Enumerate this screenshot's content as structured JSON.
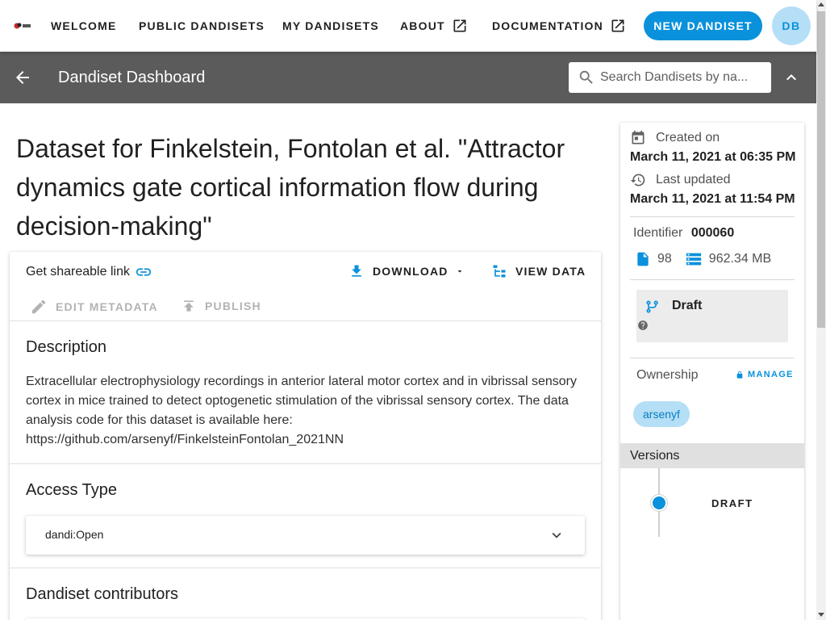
{
  "nav": {
    "welcome": "WELCOME",
    "public_dandisets": "PUBLIC DANDISETS",
    "my_dandisets": "MY DANDISETS",
    "about": "ABOUT",
    "documentation": "DOCUMENTATION",
    "new_dandiset": "NEW DANDISET",
    "user_initials": "DB"
  },
  "toolbar": {
    "title": "Dandiset Dashboard",
    "search_placeholder": "Search Dandisets by na..."
  },
  "dandiset": {
    "title": "Dataset for Finkelstein, Fontolan et al. \"Attractor dynamics gate cortical information flow during decision-making\"",
    "share_link_label": "Get shareable link",
    "download_label": "DOWNLOAD",
    "view_data_label": "VIEW DATA",
    "edit_metadata_label": "EDIT METADATA",
    "publish_label": "PUBLISH",
    "description_heading": "Description",
    "description": "Extracellular electrophysiology recordings in anterior lateral motor cortex and in vibrissal sensory cortex in mice trained to detect optogenetic stimulation of the vibrissal sensory cortex. The data analysis code for this dataset is available here: https://github.com/arsenyf/FinkelsteinFontolan_2021NN",
    "access_heading": "Access Type",
    "access_value": "dandi:Open",
    "contributors_heading": "Dandiset contributors"
  },
  "sidebar": {
    "created_label": "Created on",
    "created_date": "March 11, 2021 at 06:35 PM",
    "updated_label": "Last updated",
    "updated_date": "March 11, 2021 at 11:54 PM",
    "identifier_label": "Identifier",
    "identifier": "000060",
    "file_count": "98",
    "size": "962.34 MB",
    "version_state": "Draft",
    "ownership_label": "Ownership",
    "manage_label": "MANAGE",
    "owner": "arsenyf",
    "versions_label": "Versions",
    "versions": [
      "DRAFT"
    ]
  },
  "colors": {
    "accent": "#0a91dc",
    "toolbar": "#5b5b5b",
    "chip_bg": "#b5dff6"
  }
}
